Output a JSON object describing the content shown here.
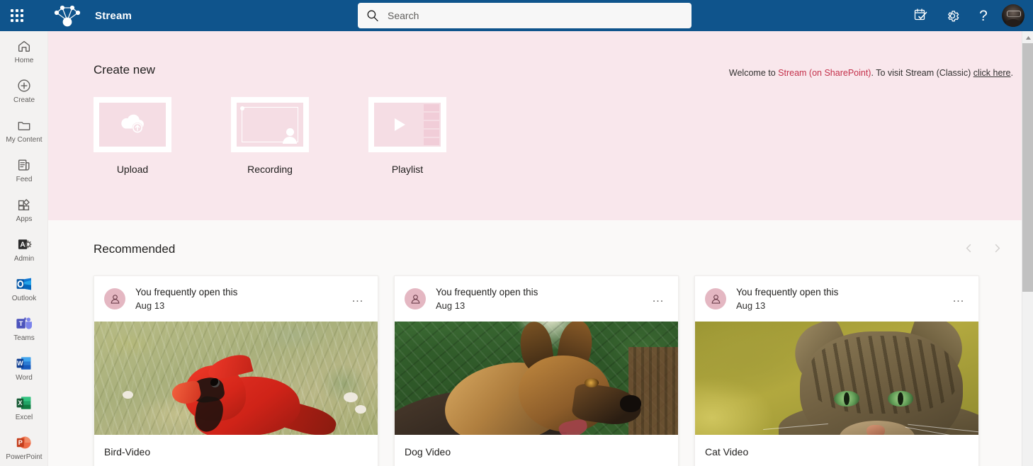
{
  "header": {
    "app_name": "Stream",
    "waffle_label": "app-launcher",
    "search": {
      "placeholder": "Search",
      "value": ""
    },
    "actions": [
      {
        "name": "feedback-icon",
        "label": "Feedback"
      },
      {
        "name": "gear-icon",
        "label": "Settings"
      },
      {
        "name": "question-icon",
        "label": "Help",
        "glyph": "?"
      }
    ],
    "account_label": "Account manager",
    "brand_color": "#0f548c"
  },
  "sidebar": {
    "items": [
      {
        "label": "Home",
        "icon": "home-icon"
      },
      {
        "label": "Create",
        "icon": "plus-circle-icon"
      },
      {
        "label": "My Content",
        "icon": "folder-icon"
      },
      {
        "label": "Feed",
        "icon": "feed-icon"
      },
      {
        "label": "Apps",
        "icon": "apps-icon"
      },
      {
        "label": "Admin",
        "icon": "admin-icon"
      },
      {
        "label": "Outlook",
        "icon": "outlook-icon"
      },
      {
        "label": "Teams",
        "icon": "teams-icon"
      },
      {
        "label": "Word",
        "icon": "word-icon"
      },
      {
        "label": "Excel",
        "icon": "excel-icon"
      },
      {
        "label": "PowerPoint",
        "icon": "powerpoint-icon"
      }
    ]
  },
  "create_new": {
    "title": "Create new",
    "banner_color": "#f9e7ec",
    "welcome": {
      "prefix": "Welcome to ",
      "accent": "Stream (on SharePoint)",
      "middle": ". To visit Stream (Classic) ",
      "link": "click here",
      "suffix": ".",
      "accent_color": "#c4314b"
    },
    "cards": [
      {
        "label": "Upload",
        "icon": "cloud-upload-icon"
      },
      {
        "label": "Recording",
        "icon": "screen-recording-icon"
      },
      {
        "label": "Playlist",
        "icon": "playlist-play-icon"
      }
    ]
  },
  "recommended": {
    "title": "Recommended",
    "prev_label": "Previous",
    "next_label": "Next",
    "videos": [
      {
        "reason": "You frequently open this",
        "date": "Aug 13",
        "title": "Bird-Video",
        "more_label": "...",
        "thumbnail": "red-cardinal-in-grass"
      },
      {
        "reason": "You frequently open this",
        "date": "Aug 13",
        "title": "Dog Video",
        "more_label": "...",
        "thumbnail": "german-shepherd-outdoors"
      },
      {
        "reason": "You frequently open this",
        "date": "Aug 13",
        "title": "Cat Video",
        "more_label": "...",
        "thumbnail": "tabby-cat-closeup"
      }
    ]
  }
}
